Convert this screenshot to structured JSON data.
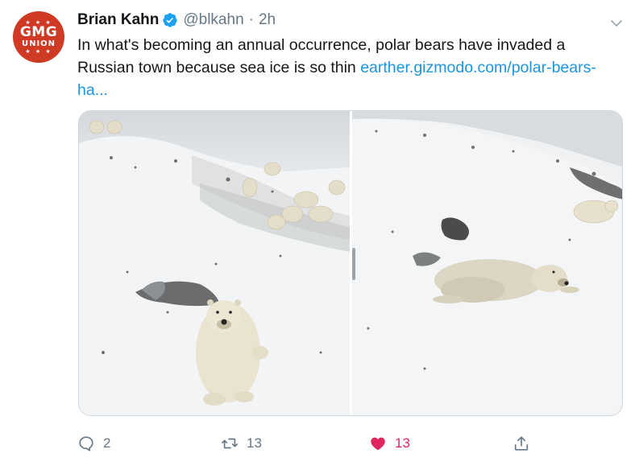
{
  "author": {
    "avatar_text": {
      "top": "GMG",
      "bottom": "UNION",
      "stars": "★ ★ ★"
    },
    "name": "Brian Kahn",
    "handle": "@blkahn",
    "separator": "·",
    "time": "2h"
  },
  "tweet": {
    "text": "In what's becoming an annual occurrence, polar bears have invaded a Russian town because sea ice is so thin ",
    "link": "earther.gizmodo.com/polar-bears-ha..."
  },
  "actions": {
    "reply_count": "2",
    "retweet_count": "13",
    "like_count": "13"
  },
  "colors": {
    "accent": "#1b95e0",
    "like": "#e0245e",
    "avatar": "#cf3a24",
    "muted": "#657786"
  }
}
